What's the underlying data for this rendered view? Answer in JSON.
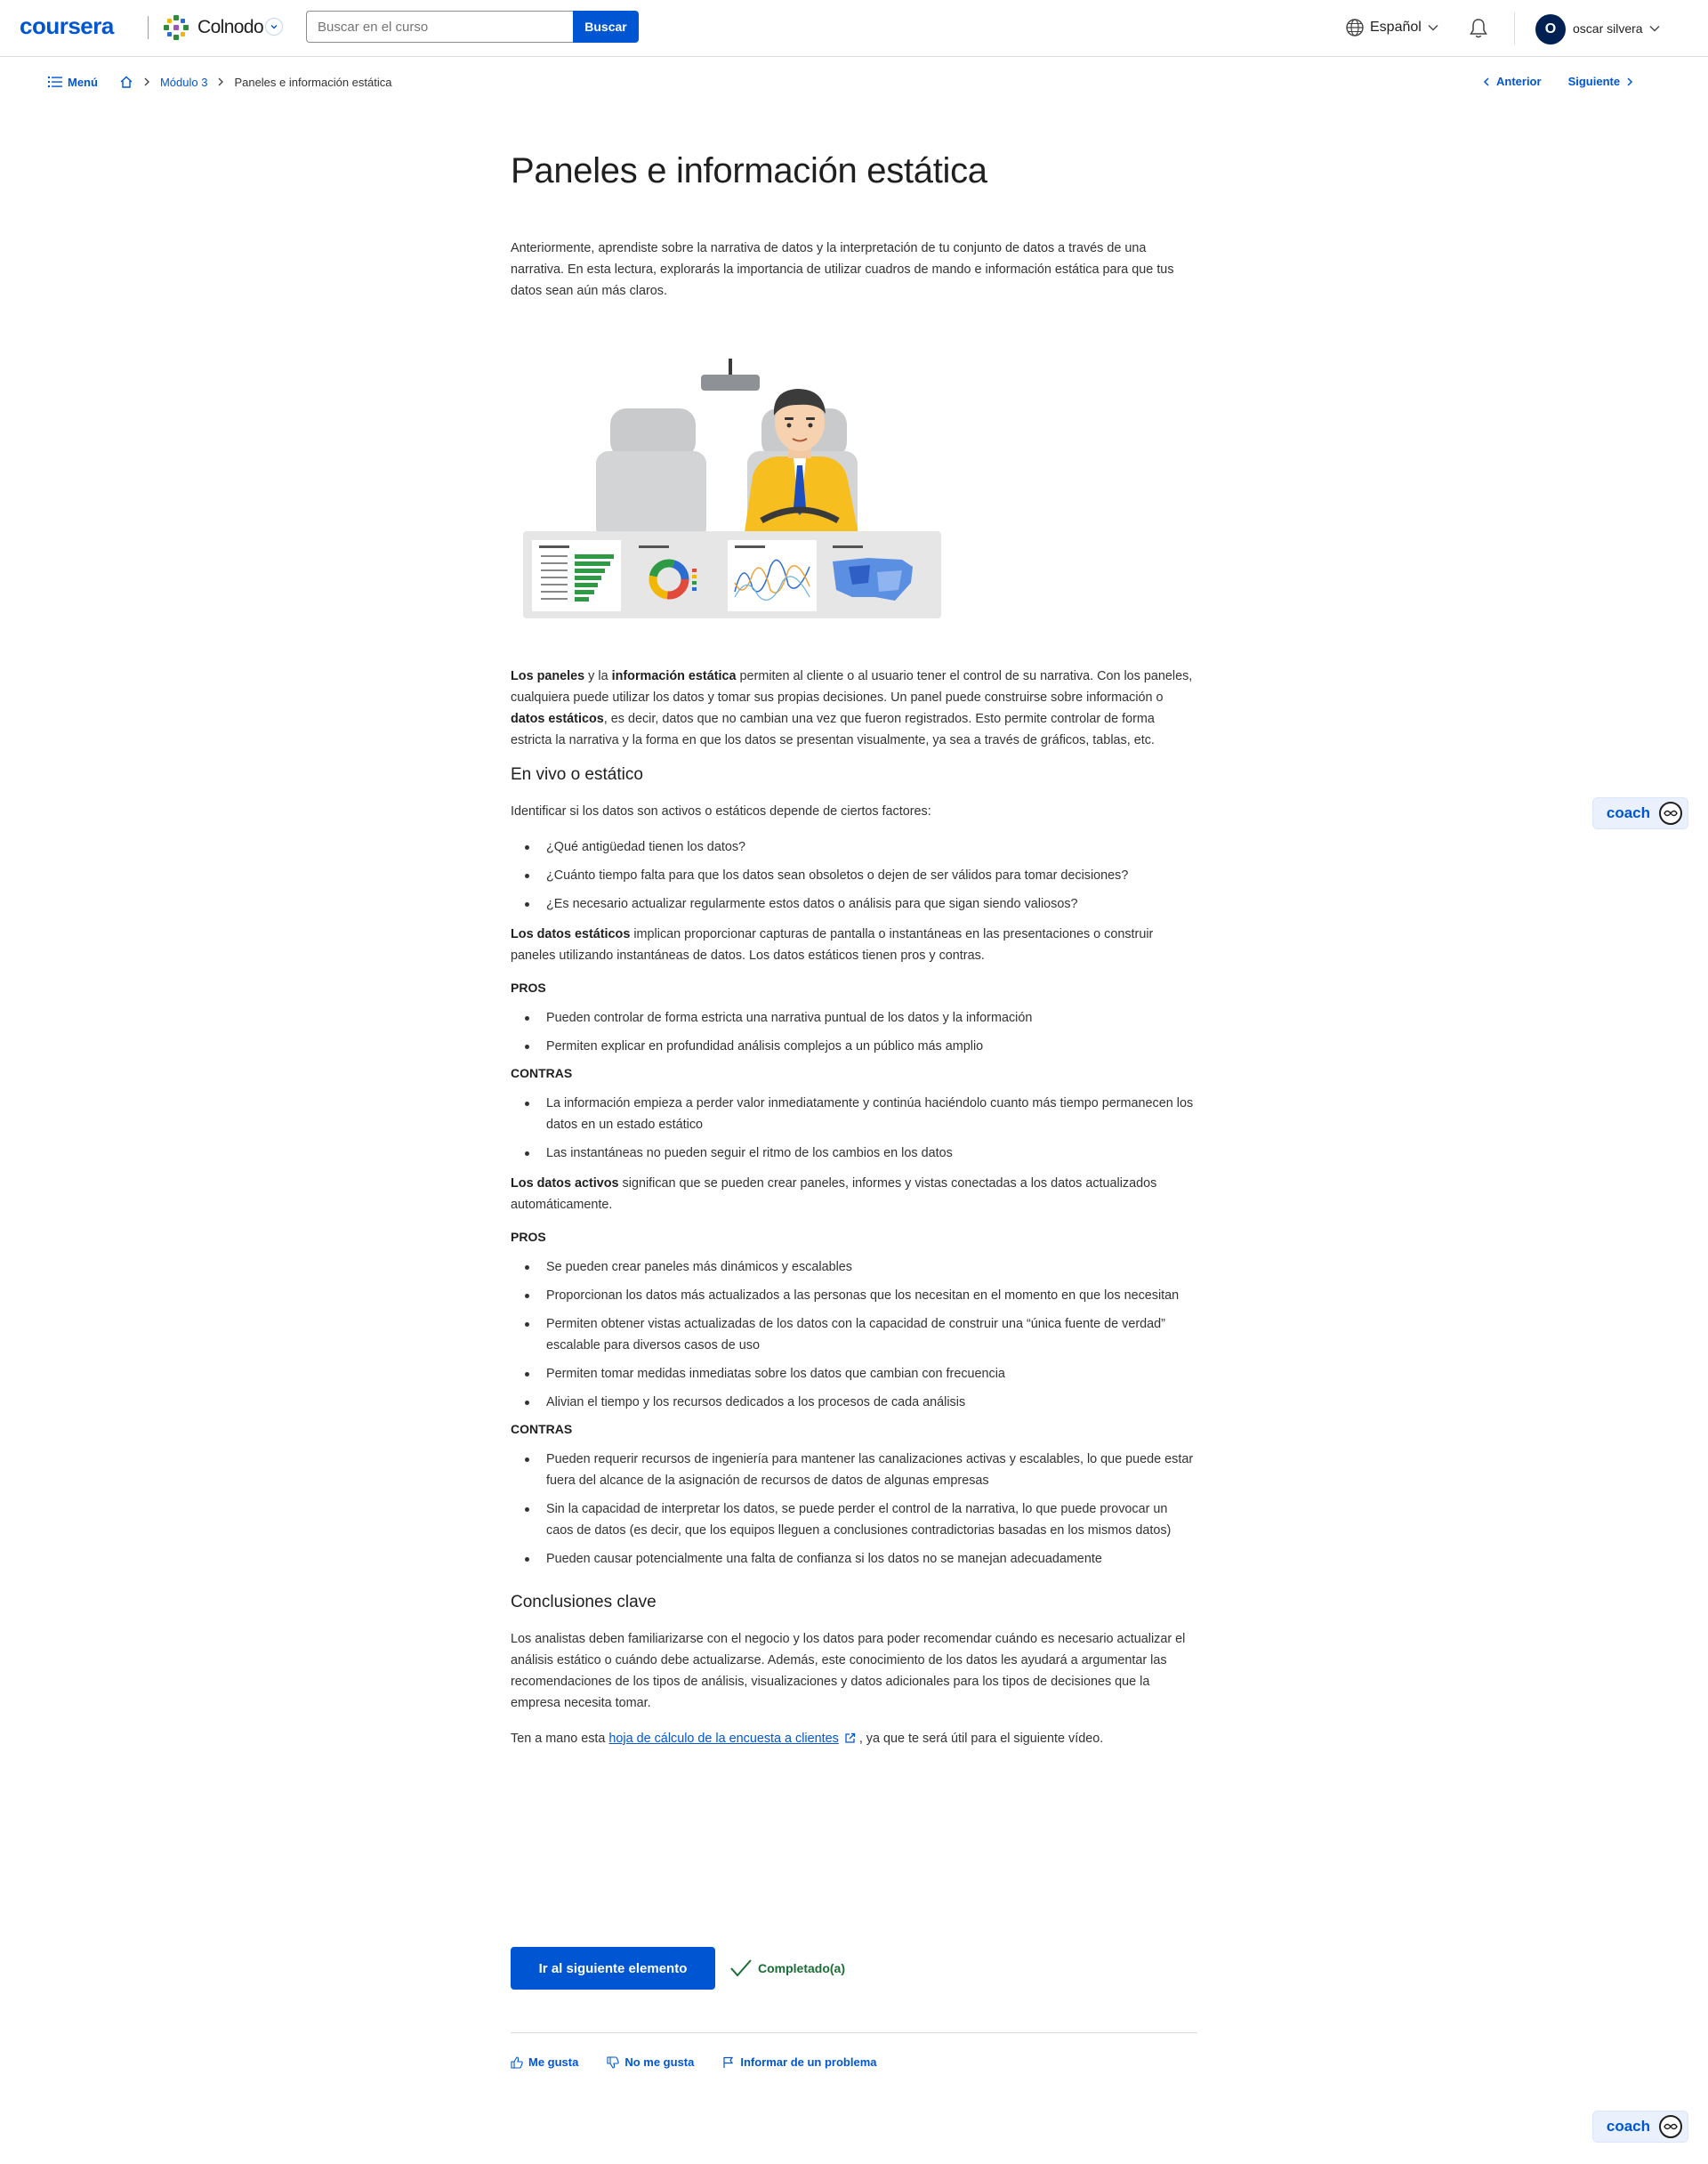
{
  "header": {
    "brand": "coursera",
    "partner": "Colnodo",
    "search_placeholder": "Buscar en el curso",
    "search_button": "Buscar",
    "language": "Español",
    "avatar_initial": "O",
    "user_name": "oscar silvera"
  },
  "breadcrumb": {
    "menu": "Menú",
    "module": "Módulo 3",
    "current": "Paneles e información estática",
    "prev": "Anterior",
    "next": "Siguiente"
  },
  "article": {
    "title": "Paneles e información estática",
    "intro": "Anteriormente, aprendiste sobre la narrativa de datos y la interpretación de tu conjunto de datos a través de una narrativa. En esta lectura, explorarás la importancia de utilizar cuadros de mando e información estática para que tus datos sean aún más claros.",
    "p1_b1": "Los paneles",
    "p1_t1": " y la ",
    "p1_b2": "información estática",
    "p1_t2": " permiten al cliente o al usuario tener el control de su narrativa. Con los paneles, cualquiera puede utilizar los datos y tomar sus propias decisiones. Un panel puede construirse sobre información o ",
    "p1_b3": "datos estáticos",
    "p1_t3": ", es decir, datos que no cambian una vez que fueron registrados. Esto permite controlar de forma estricta la narrativa y la forma en que los datos se presentan visualmente, ya sea a través de gráficos, tablas, etc.",
    "h_live": "En vivo o estático",
    "p_identify": "Identificar si los datos son activos o estáticos depende de ciertos factores:",
    "factors": [
      "¿Qué antigüedad tienen los datos?",
      "¿Cuánto tiempo falta para que los datos sean obsoletos o dejen de ser válidos para tomar decisiones?",
      "¿Es necesario actualizar regularmente estos datos o análisis para que sigan siendo valiosos?"
    ],
    "static_b": "Los datos estáticos",
    "static_t": " implican proporcionar capturas de pantalla o instantáneas en las presentaciones o construir paneles utilizando instantáneas de datos. Los datos estáticos tienen pros y contras.",
    "pros_label": "PROS",
    "contras_label": "CONTRAS",
    "static_pros": [
      "Pueden controlar de forma estricta una narrativa puntual de los datos y la información",
      "Permiten explicar en profundidad análisis complejos a un público más amplio"
    ],
    "static_cons": [
      "La información empieza a perder valor inmediatamente y continúa haciéndolo cuanto más tiempo permanecen los datos en un estado estático",
      "Las instantáneas no pueden seguir el ritmo de los cambios en los datos"
    ],
    "live_b": "Los datos activos",
    "live_t": " significan que se pueden crear paneles, informes y vistas conectadas a los datos actualizados automáticamente.",
    "live_pros": [
      "Se pueden crear paneles más dinámicos y escalables",
      "Proporcionan los datos más actualizados a las personas que los necesitan en el momento en que los necesitan",
      "Permiten obtener vistas actualizadas de los datos con la capacidad de construir una “única fuente de verdad” escalable para diversos casos de uso",
      "Permiten tomar medidas inmediatas sobre los datos que cambian con frecuencia",
      "Alivian el tiempo y los recursos dedicados a los procesos de cada análisis"
    ],
    "live_cons": [
      "Pueden requerir recursos de ingeniería para mantener las canalizaciones activas y escalables, lo que puede estar fuera del alcance de la asignación de recursos de datos de algunas empresas",
      "Sin la capacidad de interpretar los datos, se puede perder el control de la narrativa, lo que puede provocar un caos de datos (es decir, que los equipos lleguen a conclusiones contradictorias basadas en los mismos datos)",
      "Pueden causar potencialmente una falta de confianza si los datos no se manejan adecuadamente"
    ],
    "h_conclusions": "Conclusiones clave",
    "p_conclusions": "Los analistas deben familiarizarse con el negocio y los datos para poder recomendar cuándo es necesario actualizar el análisis estático o cuándo debe actualizarse. Además, este conocimiento de los datos les ayudará a argumentar las recomendaciones de los tipos de análisis, visualizaciones y datos adicionales para los tipos de decisiones que la empresa necesita tomar.",
    "final_t1": "Ten a mano esta ",
    "final_link": "hoja de cálculo de la encuesta a clientes",
    "final_t2": ", ya que te será útil para el siguiente vídeo."
  },
  "actions": {
    "next_item": "Ir al siguiente elemento",
    "completed": "Completado(a)",
    "like": "Me gusta",
    "dislike": "No me gusta",
    "report": "Informar de un problema"
  },
  "coach": {
    "label": "coach"
  },
  "colors": {
    "primary": "#0056d2",
    "success": "#1a6e35",
    "avatar_bg": "#002151"
  }
}
